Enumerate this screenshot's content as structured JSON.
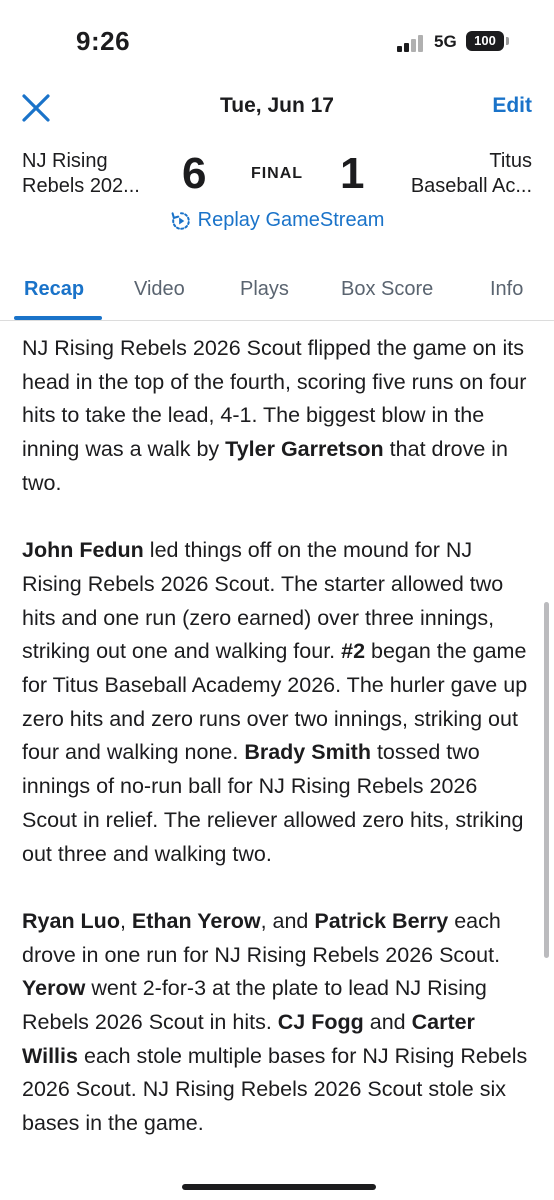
{
  "status_bar": {
    "time": "9:26",
    "network": "5G",
    "battery": "100"
  },
  "header": {
    "date": "Tue, Jun 17",
    "edit_label": "Edit",
    "close_icon": "close-icon"
  },
  "game": {
    "home_team_line1": "NJ Rising",
    "home_team_line2": "Rebels 202...",
    "home_score": "6",
    "status": "FINAL",
    "away_score": "1",
    "away_team_line1": "Titus",
    "away_team_line2": "Baseball Ac...",
    "replay_label": "Replay GameStream"
  },
  "tabs": [
    {
      "label": "Recap",
      "active": true
    },
    {
      "label": "Video"
    },
    {
      "label": "Plays"
    },
    {
      "label": "Box Score"
    },
    {
      "label": "Info"
    }
  ],
  "recap": {
    "p1": {
      "t1": "NJ Rising Rebels 2026 Scout flipped the game on its head in the top of the fourth, scoring five runs on four hits to take the lead, 4-1. The biggest blow in the inning was a walk by ",
      "b1": "Tyler Garretson",
      "t2": " that drove in two."
    },
    "p2": {
      "b1": "John Fedun",
      "t1": " led things off on the mound for NJ Rising Rebels 2026 Scout. The starter allowed two hits and one run (zero earned) over three innings, striking out one and walking four. ",
      "b2": "#2",
      "t2": " began the game for Titus Baseball Academy 2026. The hurler gave up zero hits and zero runs over two innings, striking out four and walking none. ",
      "b3": "Brady Smith",
      "t3": " tossed two innings of no-run ball for NJ Rising Rebels 2026 Scout in relief. The reliever allowed zero hits, striking out three and walking two."
    },
    "p3": {
      "b1": "Ryan Luo",
      "t1": ", ",
      "b2": "Ethan Yerow",
      "t2": ", and ",
      "b3": "Patrick Berry",
      "t3": " each drove in one run for NJ Rising Rebels 2026 Scout. ",
      "b4": "Yerow",
      "t4": " went 2-for-3 at the plate to lead NJ Rising Rebels 2026 Scout in hits. ",
      "b5": "CJ Fogg",
      "t5": " and ",
      "b6": "Carter Willis",
      "t6": " each stole multiple bases for NJ Rising Rebels 2026 Scout. NJ Rising Rebels 2026 Scout stole six bases in the game."
    }
  },
  "colors": {
    "accent": "#1a73c9",
    "text": "#1c1c1e",
    "muted": "#5a6470"
  }
}
